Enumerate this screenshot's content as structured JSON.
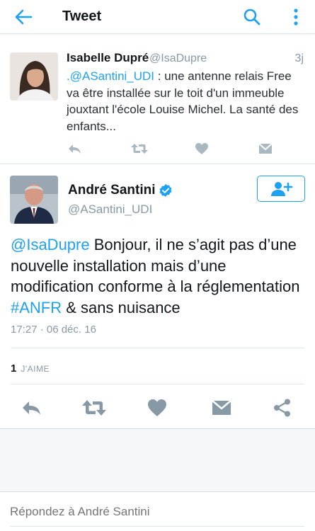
{
  "header": {
    "title": "Tweet",
    "back_icon": "arrow-left-icon",
    "search_icon": "search-icon",
    "more_icon": "more-vertical-icon",
    "accent": "#1da1f2"
  },
  "parent_tweet": {
    "author_name": "Isabelle Dupré",
    "handle": "@IsaDupre",
    "time": "3j",
    "mention": ".@ASantini_UDI",
    "text": " : une antenne relais Free va être installée sur le toit d'un immeuble jouxtant l'école Louise Michel. La santé des enfants...",
    "actions": [
      "reply-icon",
      "retweet-icon",
      "heart-icon",
      "dm-icon"
    ]
  },
  "main_tweet": {
    "author_name": "André Santini",
    "handle": "@ASantini_UDI",
    "verified": true,
    "body_mention": "@IsaDupre",
    "body_part1": " Bonjour, il ne s’agit pas d’une nouvelle installation mais d’une modification conforme à la réglementation ",
    "body_hashtag": "#ANFR",
    "body_part2": " & sans nuisance",
    "date": "17:27 · 06 déc. 16",
    "likes_count": "1",
    "likes_label": "J'AIME",
    "actions": [
      "reply-icon",
      "retweet-icon",
      "heart-icon",
      "dm-icon",
      "share-icon"
    ]
  },
  "reply_bar": {
    "placeholder": "Répondez à André Santini"
  }
}
